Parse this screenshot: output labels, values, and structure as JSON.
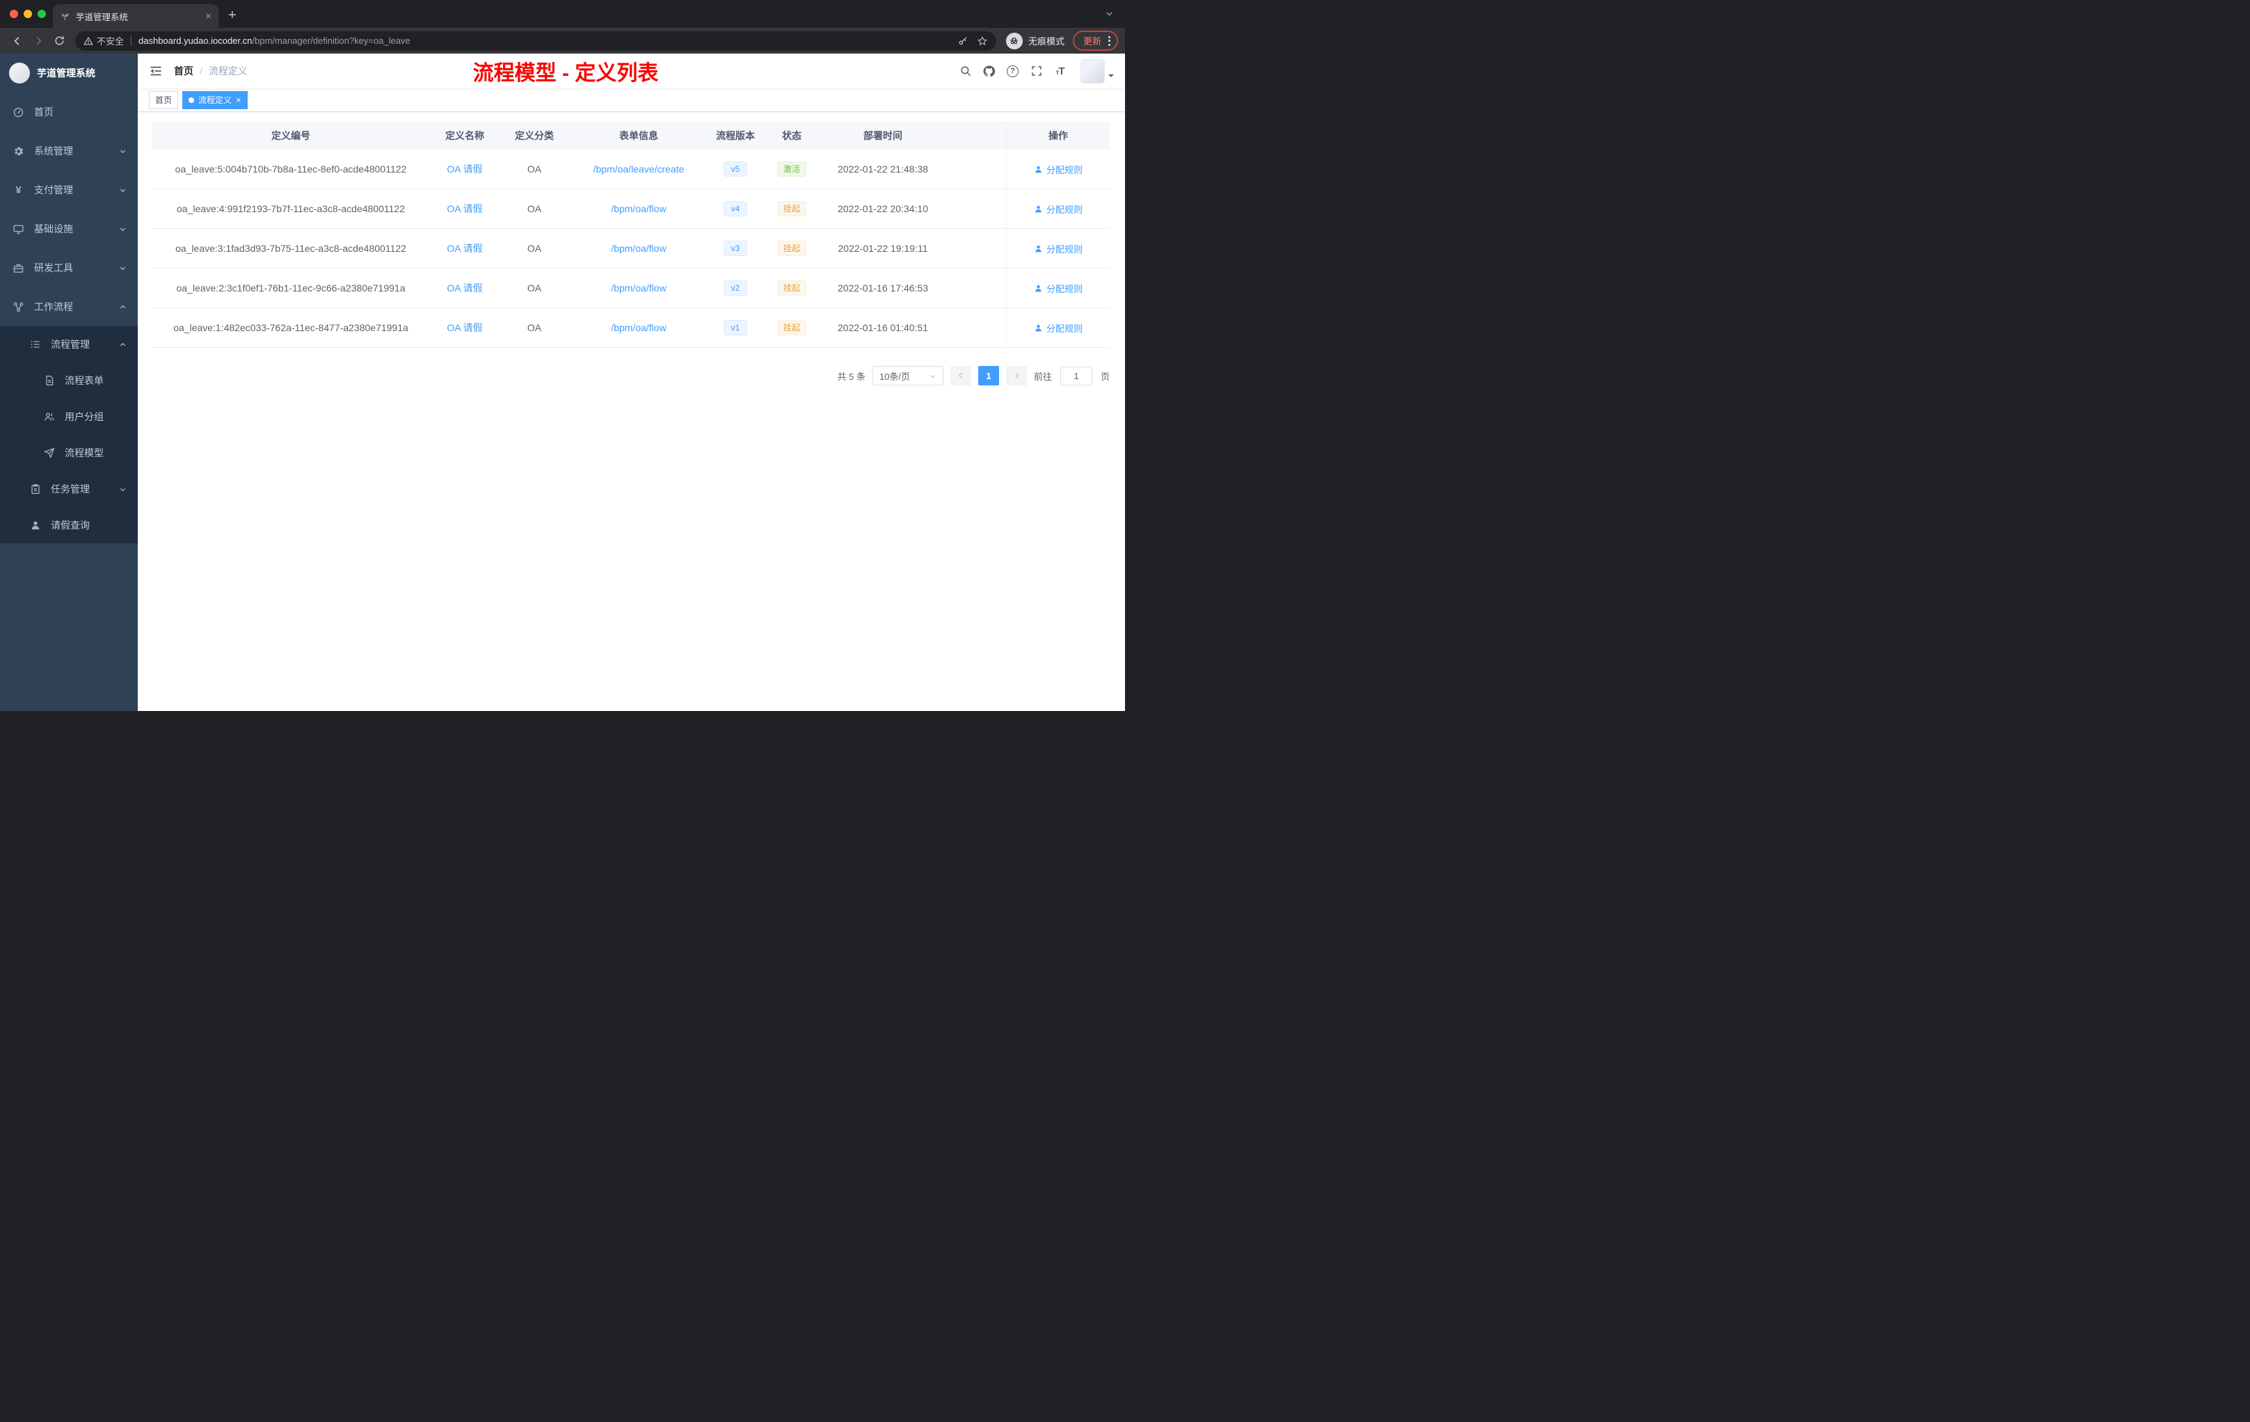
{
  "browser": {
    "tab": {
      "title": "芋道管理系统"
    },
    "address": {
      "security_label": "不安全",
      "url_host": "dashboard.yudao.iocoder.cn",
      "url_path": "/bpm/manager/definition?key=oa_leave"
    },
    "incognito_label": "无痕模式",
    "update_label": "更新"
  },
  "sidebar": {
    "app_title": "芋道管理系统",
    "items": [
      {
        "label": "首页",
        "icon": "home-icon"
      },
      {
        "label": "系统管理",
        "icon": "gear-icon"
      },
      {
        "label": "支付管理",
        "icon": "yen-icon"
      },
      {
        "label": "基础设施",
        "icon": "monitor-icon"
      },
      {
        "label": "研发工具",
        "icon": "toolbox-icon"
      },
      {
        "label": "工作流程",
        "icon": "workflow-icon"
      }
    ],
    "submenu": {
      "process_management": {
        "label": "流程管理",
        "icon": "list-icon"
      },
      "children": [
        {
          "label": "流程表单",
          "icon": "document-icon"
        },
        {
          "label": "用户分组",
          "icon": "users-icon"
        },
        {
          "label": "流程模型",
          "icon": "send-icon"
        }
      ],
      "task_management": {
        "label": "任务管理",
        "icon": "clipboard-icon"
      },
      "leave_query": {
        "label": "请假查询",
        "icon": "user-icon"
      }
    }
  },
  "header": {
    "breadcrumb": {
      "home": "首页",
      "separator": "/",
      "current": "流程定义"
    },
    "annotation": "流程模型 - 定义列表"
  },
  "tags": [
    {
      "label": "首页",
      "active": false
    },
    {
      "label": "流程定义",
      "active": true
    }
  ],
  "table": {
    "columns": [
      "定义编号",
      "定义名称",
      "定义分类",
      "表单信息",
      "流程版本",
      "状态",
      "部署时间",
      "操作"
    ],
    "rows": [
      {
        "id": "oa_leave:5:004b710b-7b8a-11ec-8ef0-acde48001122",
        "name": "OA 请假",
        "category": "OA",
        "form": "/bpm/oa/leave/create",
        "version": "v5",
        "status": "激活",
        "status_type": "success",
        "deploy_time": "2022-01-22 21:48:38",
        "action": "分配规则"
      },
      {
        "id": "oa_leave:4:991f2193-7b7f-11ec-a3c8-acde48001122",
        "name": "OA 请假",
        "category": "OA",
        "form": "/bpm/oa/flow",
        "version": "v4",
        "status": "挂起",
        "status_type": "warning",
        "deploy_time": "2022-01-22 20:34:10",
        "action": "分配规则"
      },
      {
        "id": "oa_leave:3:1fad3d93-7b75-11ec-a3c8-acde48001122",
        "name": "OA 请假",
        "category": "OA",
        "form": "/bpm/oa/flow",
        "version": "v3",
        "status": "挂起",
        "status_type": "warning",
        "deploy_time": "2022-01-22 19:19:11",
        "action": "分配规则"
      },
      {
        "id": "oa_leave:2:3c1f0ef1-76b1-11ec-9c66-a2380e71991a",
        "name": "OA 请假",
        "category": "OA",
        "form": "/bpm/oa/flow",
        "version": "v2",
        "status": "挂起",
        "status_type": "warning",
        "deploy_time": "2022-01-16 17:46:53",
        "action": "分配规则"
      },
      {
        "id": "oa_leave:1:482ec033-762a-11ec-8477-a2380e71991a",
        "name": "OA 请假",
        "category": "OA",
        "form": "/bpm/oa/flow",
        "version": "v1",
        "status": "挂起",
        "status_type": "warning",
        "deploy_time": "2022-01-16 01:40:51",
        "action": "分配规则"
      }
    ]
  },
  "pagination": {
    "total": "共 5 条",
    "page_size": "10条/页",
    "current_page": "1",
    "goto_label": "前往",
    "goto_value": "1",
    "page_unit": "页"
  },
  "colors": {
    "accent": "#409eff",
    "sidebar_bg": "#304156",
    "submenu_bg": "#1f2d3d",
    "status_active_text": "#67c23a",
    "status_suspended_text": "#e6a23c",
    "annotation_red": "#fb0300",
    "tag_active_bg": "#409eff"
  }
}
